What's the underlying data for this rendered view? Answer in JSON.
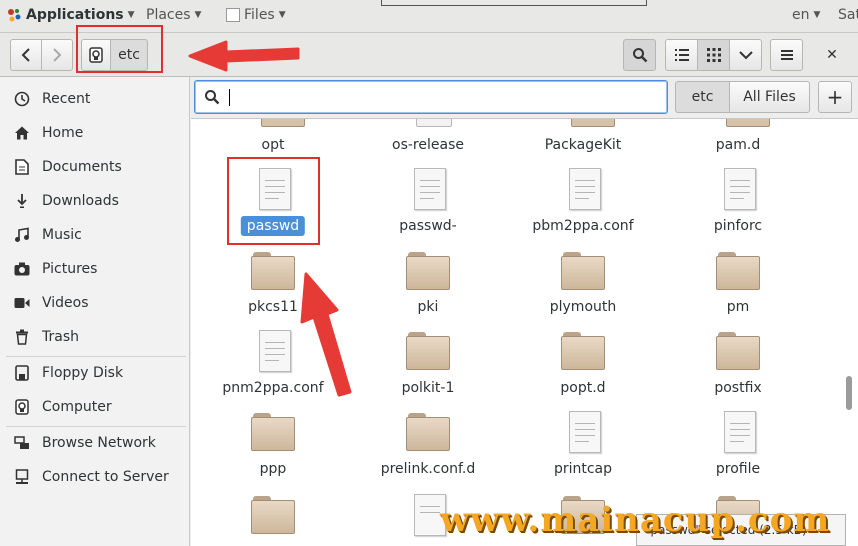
{
  "topbar": {
    "applications": "Applications",
    "places": "Places",
    "files": "Files",
    "lang": "en",
    "day": "Sat"
  },
  "header": {
    "path_segment": "etc"
  },
  "sidebar": {
    "items": [
      {
        "label": "Recent",
        "icon": "clock-icon"
      },
      {
        "label": "Home",
        "icon": "home-icon"
      },
      {
        "label": "Documents",
        "icon": "document-icon"
      },
      {
        "label": "Downloads",
        "icon": "download-icon"
      },
      {
        "label": "Music",
        "icon": "music-icon"
      },
      {
        "label": "Pictures",
        "icon": "camera-icon"
      },
      {
        "label": "Videos",
        "icon": "video-icon"
      },
      {
        "label": "Trash",
        "icon": "trash-icon"
      },
      {
        "label": "Floppy Disk",
        "icon": "floppy-icon"
      },
      {
        "label": "Computer",
        "icon": "computer-icon"
      },
      {
        "label": "Browse Network",
        "icon": "network-icon"
      },
      {
        "label": "Connect to Server",
        "icon": "server-icon"
      }
    ]
  },
  "search": {
    "value": "",
    "scope_current": "etc",
    "scope_all": "All Files"
  },
  "files": {
    "row0": [
      "opt",
      "os-release",
      "PackageKit",
      "pam.d"
    ],
    "row1": [
      "passwd",
      "passwd-",
      "pbm2ppa.conf",
      "pinforc"
    ],
    "row2": [
      "pkcs11",
      "pki",
      "plymouth",
      "pm"
    ],
    "row3": [
      "pnm2ppa.conf",
      "polkit-1",
      "popt.d",
      "postfix"
    ],
    "row4": [
      "ppp",
      "prelink.conf.d",
      "printcap",
      "profile"
    ]
  },
  "status": "\"passwd\" selected (2.5 kB)",
  "watermark": "www.mainacup.com",
  "colors": {
    "accent": "#4a90d9",
    "highlight": "#e0302c",
    "folder": "#d6c2a8"
  }
}
